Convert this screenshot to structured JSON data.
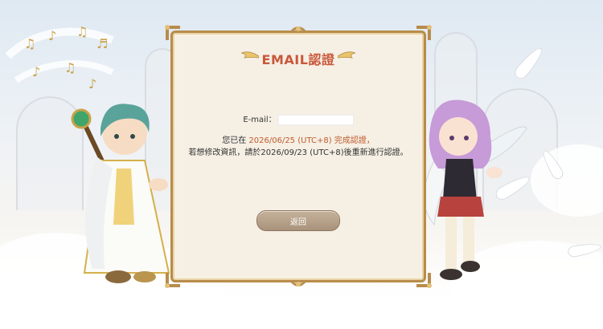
{
  "dialog": {
    "title": "EMAIL認證",
    "email_label": "E-mail：",
    "email_value": "",
    "line1_prefix": "您已在 ",
    "line1_date": "2026/06/25 (UTC+8)",
    "line1_suffix": " 完成認證，",
    "line2": "若想修改資訊，請於2026/09/23 (UTC+8)後重新進行認證。",
    "back_button": "返回"
  },
  "colors": {
    "title": "#c9583b",
    "highlight": "#c05d2e",
    "frame": "#b88c4a",
    "button": "#b09c84"
  }
}
